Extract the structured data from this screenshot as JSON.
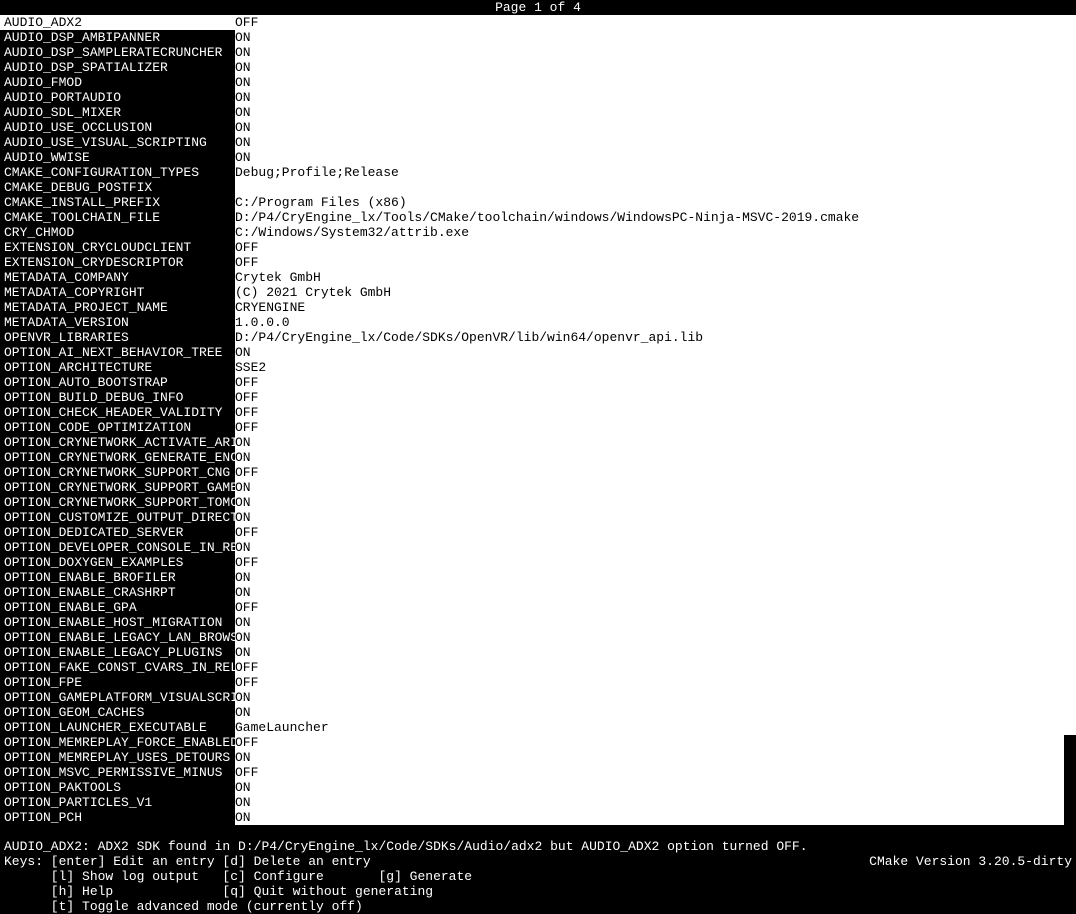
{
  "page_indicator": "Page 1 of 4",
  "selected_index": 0,
  "options": [
    {
      "name": "AUDIO_ADX2",
      "value": "OFF"
    },
    {
      "name": "AUDIO_DSP_AMBIPANNER",
      "value": "ON"
    },
    {
      "name": "AUDIO_DSP_SAMPLERATECRUNCHER",
      "value": "ON"
    },
    {
      "name": "AUDIO_DSP_SPATIALIZER",
      "value": "ON"
    },
    {
      "name": "AUDIO_FMOD",
      "value": "ON"
    },
    {
      "name": "AUDIO_PORTAUDIO",
      "value": "ON"
    },
    {
      "name": "AUDIO_SDL_MIXER",
      "value": "ON"
    },
    {
      "name": "AUDIO_USE_OCCLUSION",
      "value": "ON"
    },
    {
      "name": "AUDIO_USE_VISUAL_SCRIPTING",
      "value": "ON"
    },
    {
      "name": "AUDIO_WWISE",
      "value": "ON"
    },
    {
      "name": "CMAKE_CONFIGURATION_TYPES",
      "value": "Debug;Profile;Release"
    },
    {
      "name": "CMAKE_DEBUG_POSTFIX",
      "value": ""
    },
    {
      "name": "CMAKE_INSTALL_PREFIX",
      "value": "C:/Program Files (x86)"
    },
    {
      "name": "CMAKE_TOOLCHAIN_FILE",
      "value": "D:/P4/CryEngine_lx/Tools/CMake/toolchain/windows/WindowsPC-Ninja-MSVC-2019.cmake"
    },
    {
      "name": "CRY_CHMOD",
      "value": "C:/Windows/System32/attrib.exe"
    },
    {
      "name": "EXTENSION_CRYCLOUDCLIENT",
      "value": "OFF"
    },
    {
      "name": "EXTENSION_CRYDESCRIPTOR",
      "value": "OFF"
    },
    {
      "name": "METADATA_COMPANY",
      "value": "Crytek GmbH"
    },
    {
      "name": "METADATA_COPYRIGHT",
      "value": "(C) 2021 Crytek GmbH"
    },
    {
      "name": "METADATA_PROJECT_NAME",
      "value": "CRYENGINE"
    },
    {
      "name": "METADATA_VERSION",
      "value": "1.0.0.0"
    },
    {
      "name": "OPENVR_LIBRARIES",
      "value": "D:/P4/CryEngine_lx/Code/SDKs/OpenVR/lib/win64/openvr_api.lib"
    },
    {
      "name": "OPTION_AI_NEXT_BEHAVIOR_TREE",
      "value": "ON"
    },
    {
      "name": "OPTION_ARCHITECTURE",
      "value": "SSE2"
    },
    {
      "name": "OPTION_AUTO_BOOTSTRAP",
      "value": "OFF"
    },
    {
      "name": "OPTION_BUILD_DEBUG_INFO",
      "value": "OFF"
    },
    {
      "name": "OPTION_CHECK_HEADER_VALIDITY",
      "value": "OFF"
    },
    {
      "name": "OPTION_CODE_OPTIMIZATION",
      "value": "OFF"
    },
    {
      "name": "OPTION_CRYNETWORK_ACTIVATE_ARI",
      "value": "ON"
    },
    {
      "name": "OPTION_CRYNETWORK_GENERATE_ENC",
      "value": "ON"
    },
    {
      "name": "OPTION_CRYNETWORK_SUPPORT_CNG",
      "value": "OFF"
    },
    {
      "name": "OPTION_CRYNETWORK_SUPPORT_GAME",
      "value": "ON"
    },
    {
      "name": "OPTION_CRYNETWORK_SUPPORT_TOMC",
      "value": "ON"
    },
    {
      "name": "OPTION_CUSTOMIZE_OUTPUT_DIRECT",
      "value": "ON"
    },
    {
      "name": "OPTION_DEDICATED_SERVER",
      "value": "OFF"
    },
    {
      "name": "OPTION_DEVELOPER_CONSOLE_IN_RE",
      "value": "ON"
    },
    {
      "name": "OPTION_DOXYGEN_EXAMPLES",
      "value": "OFF"
    },
    {
      "name": "OPTION_ENABLE_BROFILER",
      "value": "ON"
    },
    {
      "name": "OPTION_ENABLE_CRASHRPT",
      "value": "ON"
    },
    {
      "name": "OPTION_ENABLE_GPA",
      "value": "OFF"
    },
    {
      "name": "OPTION_ENABLE_HOST_MIGRATION",
      "value": "ON"
    },
    {
      "name": "OPTION_ENABLE_LEGACY_LAN_BROWS",
      "value": "ON"
    },
    {
      "name": "OPTION_ENABLE_LEGACY_PLUGINS",
      "value": "ON"
    },
    {
      "name": "OPTION_FAKE_CONST_CVARS_IN_REL",
      "value": "OFF"
    },
    {
      "name": "OPTION_FPE",
      "value": "OFF"
    },
    {
      "name": "OPTION_GAMEPLATFORM_VISUALSCRI",
      "value": "ON"
    },
    {
      "name": "OPTION_GEOM_CACHES",
      "value": "ON"
    },
    {
      "name": "OPTION_LAUNCHER_EXECUTABLE",
      "value": "GameLauncher"
    },
    {
      "name": "OPTION_MEMREPLAY_FORCE_ENABLED",
      "value": "OFF"
    },
    {
      "name": "OPTION_MEMREPLAY_USES_DETOURS",
      "value": "ON"
    },
    {
      "name": "OPTION_MSVC_PERMISSIVE_MINUS",
      "value": "OFF"
    },
    {
      "name": "OPTION_PAKTOOLS",
      "value": "ON"
    },
    {
      "name": "OPTION_PARTICLES_V1",
      "value": "ON"
    },
    {
      "name": "OPTION_PCH",
      "value": "ON"
    }
  ],
  "status_message": "AUDIO_ADX2: ADX2 SDK found in D:/P4/CryEngine_lx/Code/SDKs/Audio/adx2 but AUDIO_ADX2 option turned OFF.",
  "cmake_version": "CMake Version 3.20.5-dirty",
  "help": {
    "line1": "Keys: [enter] Edit an entry [d] Delete an entry",
    "line2": "      [l] Show log output   [c] Configure       [g] Generate",
    "line3": "      [h] Help              [q] Quit without generating",
    "line4": "      [t] Toggle advanced mode (currently off)"
  }
}
